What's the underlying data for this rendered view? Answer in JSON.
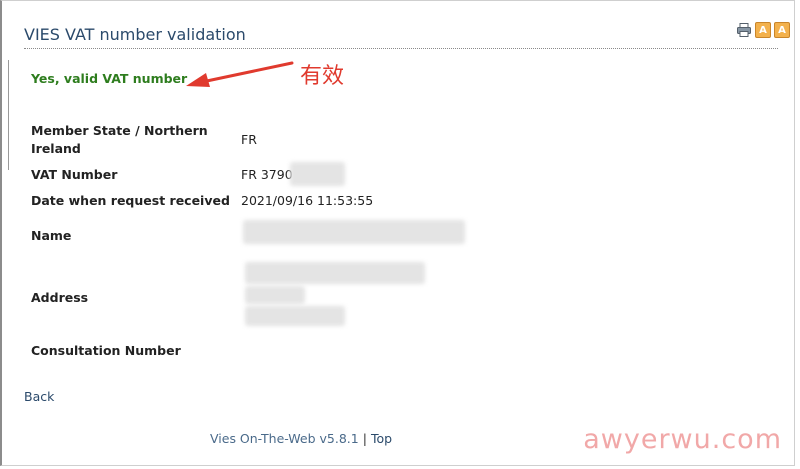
{
  "header": {
    "title": "VIES VAT number validation",
    "icons": [
      "printer-icon",
      "font-decrease-icon",
      "font-increase-icon"
    ],
    "font_icon_glyph": "A"
  },
  "result": {
    "message": "Yes, valid VAT number",
    "annotation": "有效"
  },
  "details": {
    "member_state_label": "Member State / Northern Ireland",
    "member_state_value": "FR",
    "vat_number_label": "VAT Number",
    "vat_number_value": "FR 3790",
    "date_label": "Date when request received",
    "date_value": "2021/09/16 11:53:55",
    "name_label": "Name",
    "address_label": "Address",
    "consultation_label": "Consultation Number"
  },
  "nav": {
    "back": "Back"
  },
  "footer": {
    "app": "Vies On-The-Web v5.8.1",
    "separator": "|",
    "top": "Top"
  },
  "watermark": "awyerwu.com",
  "colors": {
    "title": "#2b4a6b",
    "valid": "#2e7d1e",
    "annotation": "#e03a2e",
    "watermark": "#f1a8a8"
  }
}
